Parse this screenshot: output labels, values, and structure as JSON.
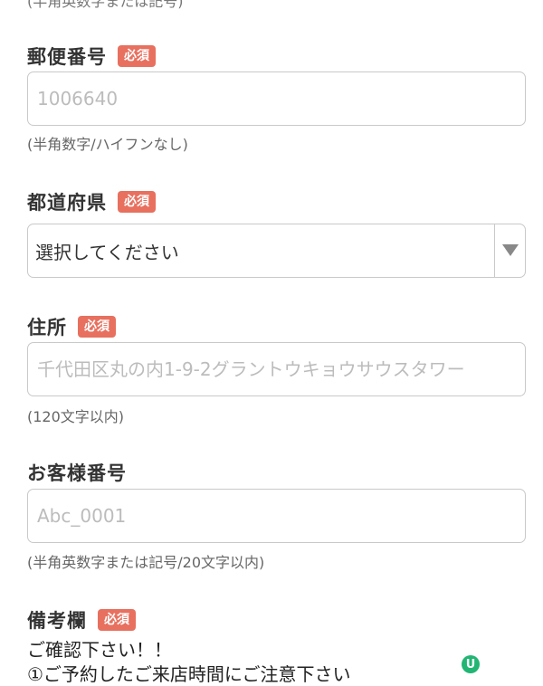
{
  "top_hint": "(半角英数字または記号)",
  "postal": {
    "label": "郵便番号",
    "badge": "必須",
    "placeholder": "1006640",
    "hint": "(半角数字/ハイフンなし)"
  },
  "prefecture": {
    "label": "都道府県",
    "badge": "必須",
    "selected": "選択してください"
  },
  "address": {
    "label": "住所",
    "badge": "必須",
    "placeholder": "千代田区丸の内1-9-2グラントウキョウサウスタワー",
    "hint": "(120文字以内)"
  },
  "customer_number": {
    "label": "お客様番号",
    "placeholder": "Abc_0001",
    "hint": "(半角英数字または記号/20文字以内)"
  },
  "remarks": {
    "label": "備考欄",
    "badge": "必須",
    "line1": "ご確認下さい！！",
    "line2": "①ご予約したご来店時間にご注意下さい"
  },
  "float_button": {
    "icon": "u-logo-icon",
    "text": "U"
  },
  "colors": {
    "badge": "#e8705f",
    "border": "#c9c9c9",
    "float": "#22b573"
  }
}
